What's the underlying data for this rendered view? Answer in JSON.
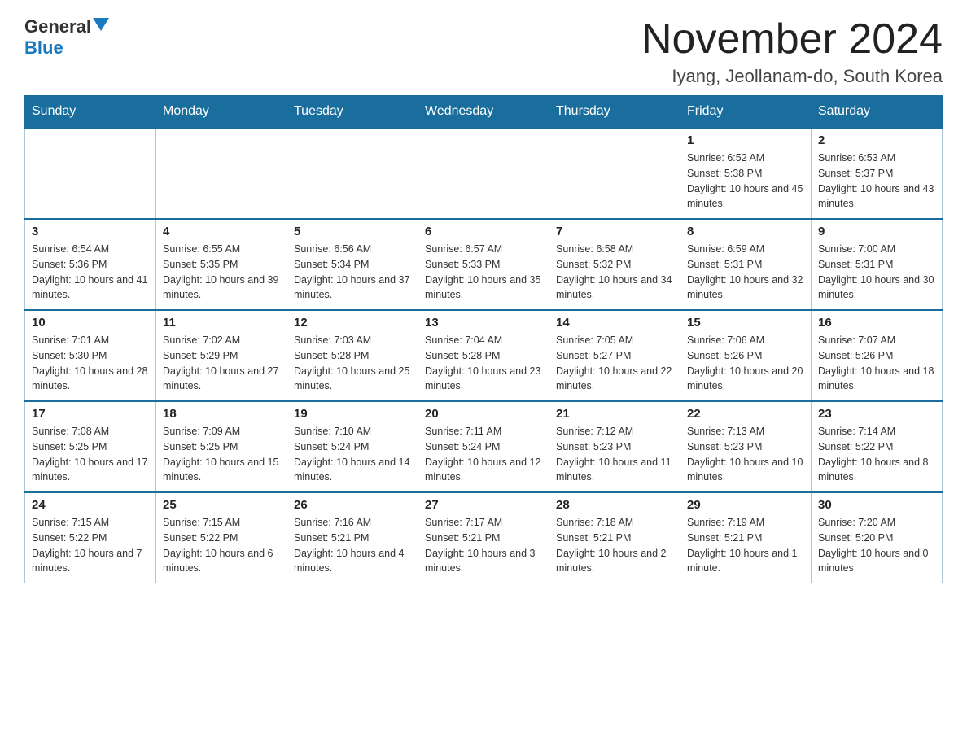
{
  "logo": {
    "general": "General",
    "blue": "Blue"
  },
  "title": "November 2024",
  "location": "Iyang, Jeollanam-do, South Korea",
  "weekdays": [
    "Sunday",
    "Monday",
    "Tuesday",
    "Wednesday",
    "Thursday",
    "Friday",
    "Saturday"
  ],
  "weeks": [
    [
      {
        "day": "",
        "info": ""
      },
      {
        "day": "",
        "info": ""
      },
      {
        "day": "",
        "info": ""
      },
      {
        "day": "",
        "info": ""
      },
      {
        "day": "",
        "info": ""
      },
      {
        "day": "1",
        "info": "Sunrise: 6:52 AM\nSunset: 5:38 PM\nDaylight: 10 hours and 45 minutes."
      },
      {
        "day": "2",
        "info": "Sunrise: 6:53 AM\nSunset: 5:37 PM\nDaylight: 10 hours and 43 minutes."
      }
    ],
    [
      {
        "day": "3",
        "info": "Sunrise: 6:54 AM\nSunset: 5:36 PM\nDaylight: 10 hours and 41 minutes."
      },
      {
        "day": "4",
        "info": "Sunrise: 6:55 AM\nSunset: 5:35 PM\nDaylight: 10 hours and 39 minutes."
      },
      {
        "day": "5",
        "info": "Sunrise: 6:56 AM\nSunset: 5:34 PM\nDaylight: 10 hours and 37 minutes."
      },
      {
        "day": "6",
        "info": "Sunrise: 6:57 AM\nSunset: 5:33 PM\nDaylight: 10 hours and 35 minutes."
      },
      {
        "day": "7",
        "info": "Sunrise: 6:58 AM\nSunset: 5:32 PM\nDaylight: 10 hours and 34 minutes."
      },
      {
        "day": "8",
        "info": "Sunrise: 6:59 AM\nSunset: 5:31 PM\nDaylight: 10 hours and 32 minutes."
      },
      {
        "day": "9",
        "info": "Sunrise: 7:00 AM\nSunset: 5:31 PM\nDaylight: 10 hours and 30 minutes."
      }
    ],
    [
      {
        "day": "10",
        "info": "Sunrise: 7:01 AM\nSunset: 5:30 PM\nDaylight: 10 hours and 28 minutes."
      },
      {
        "day": "11",
        "info": "Sunrise: 7:02 AM\nSunset: 5:29 PM\nDaylight: 10 hours and 27 minutes."
      },
      {
        "day": "12",
        "info": "Sunrise: 7:03 AM\nSunset: 5:28 PM\nDaylight: 10 hours and 25 minutes."
      },
      {
        "day": "13",
        "info": "Sunrise: 7:04 AM\nSunset: 5:28 PM\nDaylight: 10 hours and 23 minutes."
      },
      {
        "day": "14",
        "info": "Sunrise: 7:05 AM\nSunset: 5:27 PM\nDaylight: 10 hours and 22 minutes."
      },
      {
        "day": "15",
        "info": "Sunrise: 7:06 AM\nSunset: 5:26 PM\nDaylight: 10 hours and 20 minutes."
      },
      {
        "day": "16",
        "info": "Sunrise: 7:07 AM\nSunset: 5:26 PM\nDaylight: 10 hours and 18 minutes."
      }
    ],
    [
      {
        "day": "17",
        "info": "Sunrise: 7:08 AM\nSunset: 5:25 PM\nDaylight: 10 hours and 17 minutes."
      },
      {
        "day": "18",
        "info": "Sunrise: 7:09 AM\nSunset: 5:25 PM\nDaylight: 10 hours and 15 minutes."
      },
      {
        "day": "19",
        "info": "Sunrise: 7:10 AM\nSunset: 5:24 PM\nDaylight: 10 hours and 14 minutes."
      },
      {
        "day": "20",
        "info": "Sunrise: 7:11 AM\nSunset: 5:24 PM\nDaylight: 10 hours and 12 minutes."
      },
      {
        "day": "21",
        "info": "Sunrise: 7:12 AM\nSunset: 5:23 PM\nDaylight: 10 hours and 11 minutes."
      },
      {
        "day": "22",
        "info": "Sunrise: 7:13 AM\nSunset: 5:23 PM\nDaylight: 10 hours and 10 minutes."
      },
      {
        "day": "23",
        "info": "Sunrise: 7:14 AM\nSunset: 5:22 PM\nDaylight: 10 hours and 8 minutes."
      }
    ],
    [
      {
        "day": "24",
        "info": "Sunrise: 7:15 AM\nSunset: 5:22 PM\nDaylight: 10 hours and 7 minutes."
      },
      {
        "day": "25",
        "info": "Sunrise: 7:15 AM\nSunset: 5:22 PM\nDaylight: 10 hours and 6 minutes."
      },
      {
        "day": "26",
        "info": "Sunrise: 7:16 AM\nSunset: 5:21 PM\nDaylight: 10 hours and 4 minutes."
      },
      {
        "day": "27",
        "info": "Sunrise: 7:17 AM\nSunset: 5:21 PM\nDaylight: 10 hours and 3 minutes."
      },
      {
        "day": "28",
        "info": "Sunrise: 7:18 AM\nSunset: 5:21 PM\nDaylight: 10 hours and 2 minutes."
      },
      {
        "day": "29",
        "info": "Sunrise: 7:19 AM\nSunset: 5:21 PM\nDaylight: 10 hours and 1 minute."
      },
      {
        "day": "30",
        "info": "Sunrise: 7:20 AM\nSunset: 5:20 PM\nDaylight: 10 hours and 0 minutes."
      }
    ]
  ]
}
